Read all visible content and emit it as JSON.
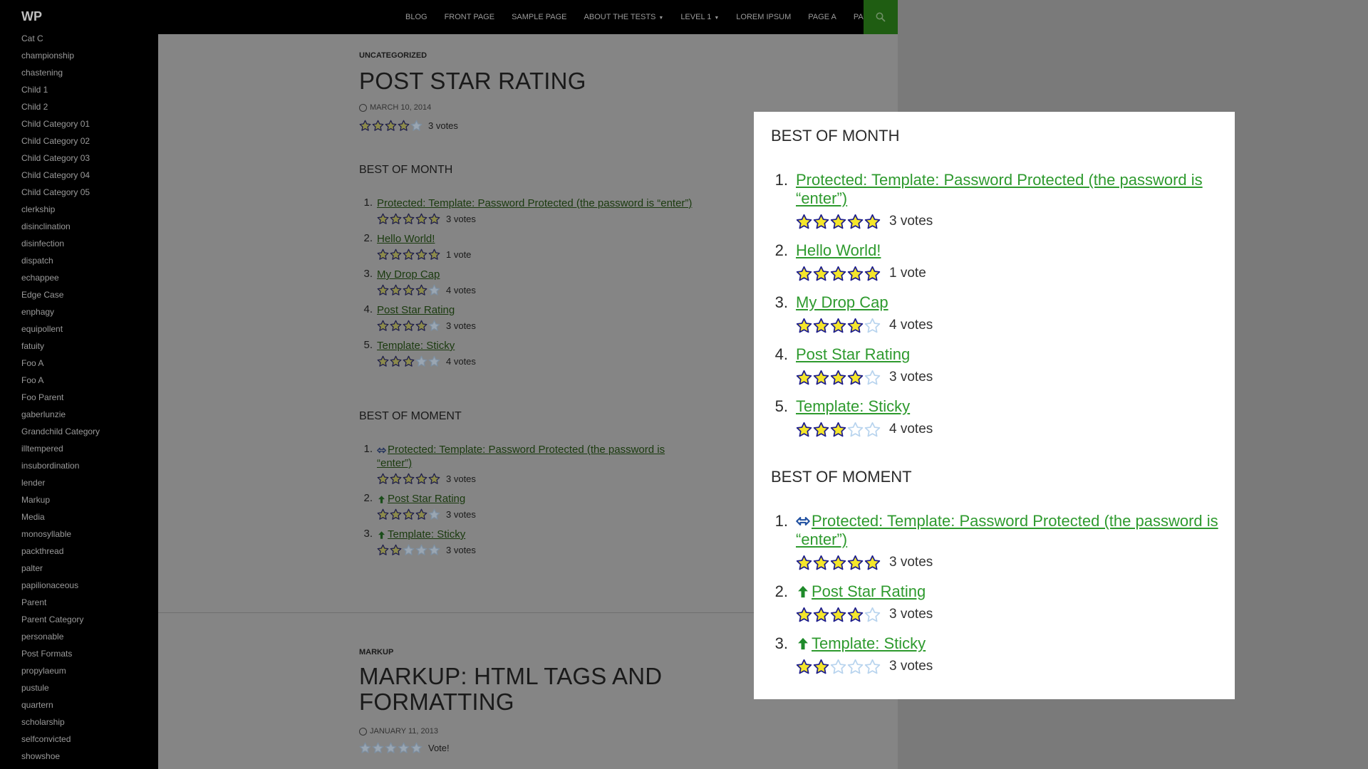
{
  "site": {
    "title": "WP"
  },
  "nav": {
    "items": [
      {
        "label": "BLOG"
      },
      {
        "label": "FRONT PAGE"
      },
      {
        "label": "SAMPLE PAGE"
      },
      {
        "label": "ABOUT THE TESTS",
        "has_submenu": true
      },
      {
        "label": "LEVEL 1",
        "has_submenu": true
      },
      {
        "label": "LOREM IPSUM"
      },
      {
        "label": "PAGE A"
      },
      {
        "label": "PAGE B"
      }
    ],
    "search_icon": "search-icon"
  },
  "sidebar": {
    "categories": [
      "Cat C",
      "championship",
      "chastening",
      "Child 1",
      "Child 2",
      "Child Category 01",
      "Child Category 02",
      "Child Category 03",
      "Child Category 04",
      "Child Category 05",
      "clerkship",
      "disinclination",
      "disinfection",
      "dispatch",
      "echappee",
      "Edge Case",
      "enphagy",
      "equipollent",
      "fatuity",
      "Foo A",
      "Foo A",
      "Foo Parent",
      "gaberlunzie",
      "Grandchild Category",
      "illtempered",
      "insubordination",
      "lender",
      "Markup",
      "Media",
      "monosyllable",
      "packthread",
      "palter",
      "papilionaceous",
      "Parent",
      "Parent Category",
      "personable",
      "Post Formats",
      "propylaeum",
      "pustule",
      "quartern",
      "scholarship",
      "selfconvicted",
      "showshoe"
    ]
  },
  "entry1": {
    "category": "UNCATEGORIZED",
    "title": "POST STAR RATING",
    "date": "MARCH 10, 2014",
    "rating": 4,
    "votes": "3 votes",
    "best_of_month": {
      "heading": "BEST OF MONTH",
      "items": [
        {
          "num": "1.",
          "title": "Protected: Template: Password Protected (the password is “enter”)",
          "rating": 5,
          "votes": "3 votes"
        },
        {
          "num": "2.",
          "title": "Hello World!",
          "rating": 5,
          "votes": "1 vote"
        },
        {
          "num": "3.",
          "title": "My Drop Cap",
          "rating": 4,
          "votes": "4 votes"
        },
        {
          "num": "4.",
          "title": "Post Star Rating",
          "rating": 4,
          "votes": "3 votes"
        },
        {
          "num": "5.",
          "title": "Template: Sticky",
          "rating": 3,
          "votes": "4 votes"
        }
      ]
    },
    "best_of_moment": {
      "heading": "BEST OF MOMENT",
      "items": [
        {
          "num": "1.",
          "trend": "same",
          "title": "Protected: Template: Password Protected (the password is “enter”)",
          "rating": 5,
          "votes": "3 votes"
        },
        {
          "num": "2.",
          "trend": "up",
          "title": "Post Star Rating",
          "rating": 4,
          "votes": "3 votes"
        },
        {
          "num": "3.",
          "trend": "up",
          "title": "Template: Sticky",
          "rating": 2,
          "votes": "3 votes"
        }
      ]
    }
  },
  "entry2": {
    "category": "MARKUP",
    "title": "MARKUP: HTML TAGS AND FORMATTING",
    "date": "JANUARY 11, 2013",
    "rating": 0,
    "votes": "Vote!"
  },
  "popup": {
    "best_of_month": {
      "heading": "BEST OF MONTH",
      "items": [
        {
          "num": "1.",
          "title": "Protected: Template: Password Protected (the password is “enter”)",
          "rating": 5,
          "votes": "3 votes"
        },
        {
          "num": "2.",
          "title": "Hello World!",
          "rating": 5,
          "votes": "1 vote"
        },
        {
          "num": "3.",
          "title": "My Drop Cap",
          "rating": 4,
          "votes": "4 votes"
        },
        {
          "num": "4.",
          "title": "Post Star Rating",
          "rating": 4,
          "votes": "3 votes"
        },
        {
          "num": "5.",
          "title": "Template: Sticky",
          "rating": 3,
          "votes": "4 votes"
        }
      ]
    },
    "best_of_moment": {
      "heading": "BEST OF MOMENT",
      "items": [
        {
          "num": "1.",
          "trend": "same",
          "title": "Protected: Template: Password Protected (the password is “enter”)",
          "rating": 5,
          "votes": "3 votes"
        },
        {
          "num": "2.",
          "trend": "up",
          "title": "Post Star Rating",
          "rating": 4,
          "votes": "3 votes"
        },
        {
          "num": "3.",
          "trend": "up",
          "title": "Template: Sticky",
          "rating": 2,
          "votes": "3 votes"
        }
      ]
    }
  },
  "colors": {
    "link_green": "#2e9a2e",
    "star_fill": "#f5e62a",
    "star_outline": "#1c1c8c",
    "star_empty": "#b8d4ee",
    "nav_search_bg": "#1f5d12"
  }
}
